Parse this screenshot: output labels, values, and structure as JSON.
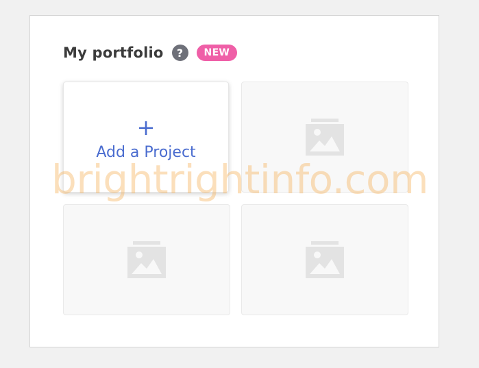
{
  "portfolio": {
    "title": "My portfolio",
    "help_glyph": "?",
    "badge": "NEW",
    "add_project_glyph": "+",
    "add_project_label": "Add a Project",
    "placeholder_icon": "image-icon"
  },
  "watermark": {
    "text": "brightrightinfo.com"
  },
  "colors": {
    "accent": "#4a6ccf",
    "badge": "#ef5fa7",
    "help": "#6e7079",
    "placeholder_icon": "#e3e3e3"
  }
}
